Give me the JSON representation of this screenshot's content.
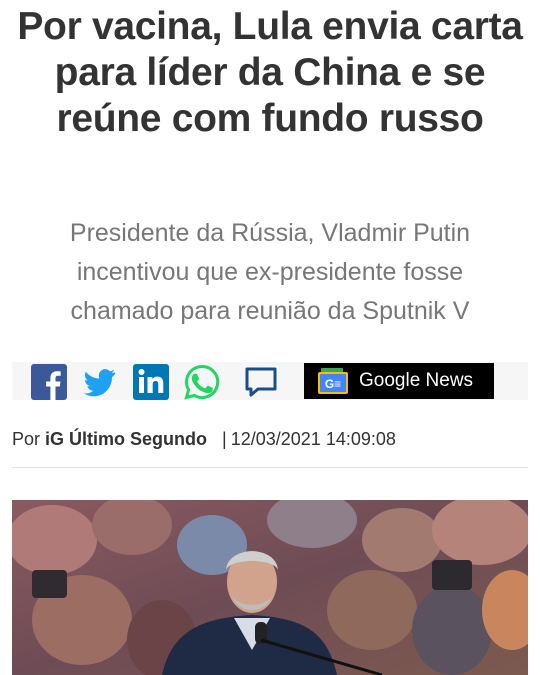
{
  "article": {
    "headline": "Por vacina, Lula envia carta para líder da China e se reúne com fundo russo",
    "subtitle": "Presidente da Rússia, Vladmir Putin incentivou que ex-presidente fosse chamado para reunião da Sputnik V"
  },
  "share": {
    "icons": [
      "facebook-icon",
      "twitter-icon",
      "linkedin-icon",
      "whatsapp-icon",
      "comment-icon"
    ],
    "google_news_label": "Google News",
    "google_news_logo_text": "G≡"
  },
  "byline": {
    "prefix": "Por",
    "author": "iG Último Segundo",
    "separator": "|",
    "datetime": "12/03/2021 14:09:08"
  },
  "colors": {
    "headline": "#333333",
    "subtitle": "#777777",
    "facebook": "#3b5998",
    "twitter": "#1da1f2",
    "linkedin": "#0077b5",
    "whatsapp": "#25d366",
    "comment": "#1b4d8a"
  }
}
